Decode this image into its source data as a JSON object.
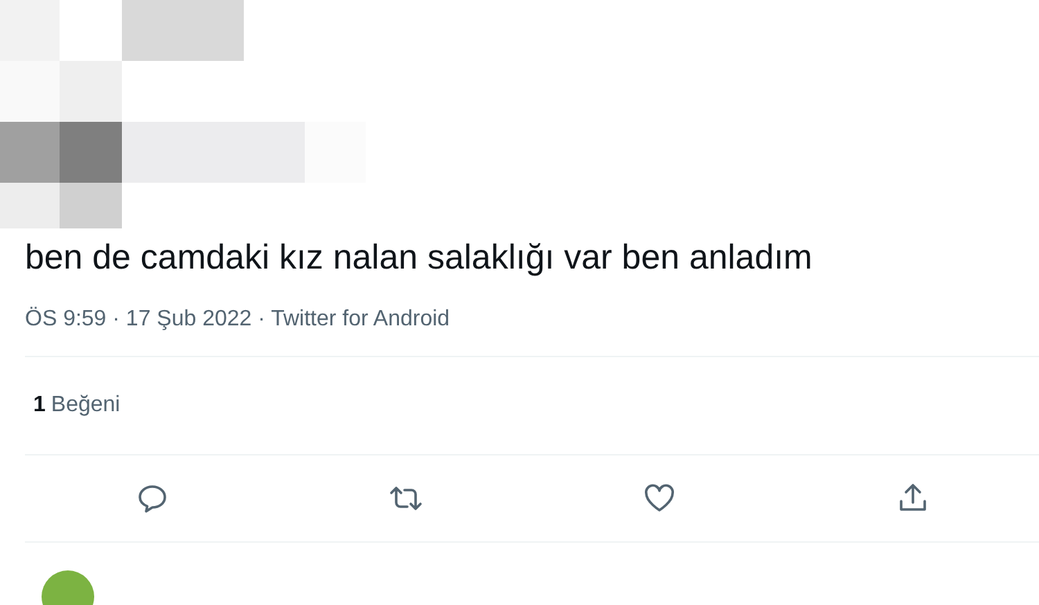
{
  "tweet": {
    "text": "ben de camdaki kız nalan salaklığı var ben anladım",
    "meta": "ÖS 9:59 · 17 Şub 2022 · Twitter for Android"
  },
  "likes": {
    "count": "1",
    "label": "Beğeni"
  },
  "actions": [
    {
      "kind": "reply"
    },
    {
      "kind": "retweet"
    },
    {
      "kind": "like"
    },
    {
      "kind": "share"
    }
  ]
}
